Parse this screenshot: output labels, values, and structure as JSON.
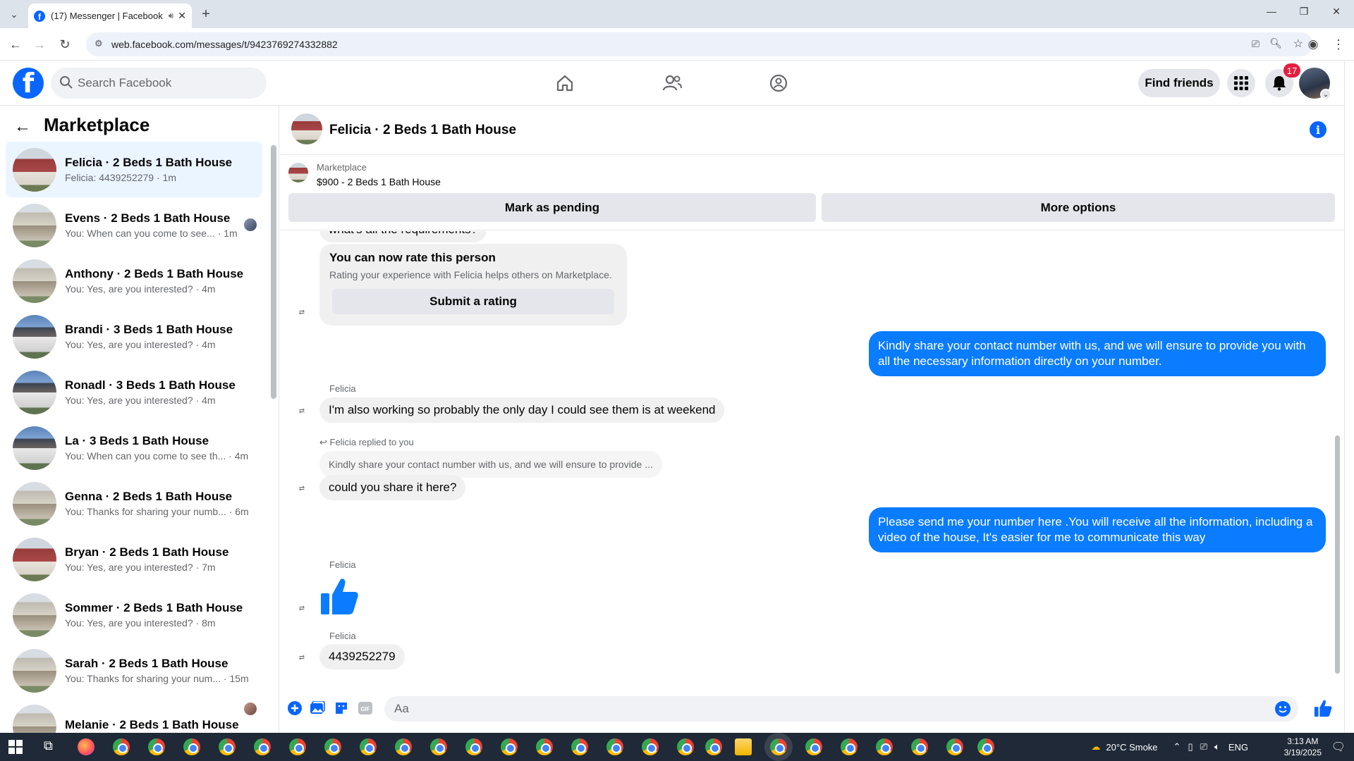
{
  "browser": {
    "tab_title": "(17) Messenger | Facebook",
    "url": "web.facebook.com/messages/t/9423769274332882"
  },
  "fb": {
    "search_placeholder": "Search Facebook",
    "find_friends": "Find friends",
    "notif_count": "17"
  },
  "sidebar": {
    "title": "Marketplace",
    "conversations": [
      {
        "name": "Felicia · 2 Beds 1 Bath House",
        "preview": "Felicia: 4439252279 · 1m",
        "thumb": "house1",
        "active": true
      },
      {
        "name": "Evens · 2 Beds 1 Bath House",
        "preview": "You: When can you come to see... · 1m",
        "thumb": "house2",
        "seen": true
      },
      {
        "name": "Anthony · 2 Beds 1 Bath House",
        "preview": "You: Yes, are you interested? · 4m",
        "thumb": "house2"
      },
      {
        "name": "Brandi · 3 Beds 1 Bath House",
        "preview": "You: Yes, are you interested? · 4m",
        "thumb": "house3"
      },
      {
        "name": "Ronadl · 3 Beds 1 Bath House",
        "preview": "You: Yes, are you interested? · 4m",
        "thumb": "house3"
      },
      {
        "name": "La · 3 Beds 1 Bath House",
        "preview": "You: When can you come to see th... · 4m",
        "thumb": "house3"
      },
      {
        "name": "Genna · 2 Beds 1 Bath House",
        "preview": "You: Thanks for sharing your numb... · 6m",
        "thumb": "house2"
      },
      {
        "name": "Bryan · 2 Beds 1 Bath House",
        "preview": "You: Yes, are you interested? · 7m",
        "thumb": "house1"
      },
      {
        "name": "Sommer · 2 Beds 1 Bath House",
        "preview": "You: Yes, are you interested? · 8m",
        "thumb": "house2"
      },
      {
        "name": "Sarah · 2 Beds 1 Bath House",
        "preview": "You: Thanks for sharing your num... · 15m",
        "thumb": "house2"
      },
      {
        "name": "Melanie · 2 Beds 1 Bath House",
        "preview": "",
        "thumb": "house2",
        "seen": true
      }
    ]
  },
  "chat": {
    "title": "Felicia · 2 Beds 1 Bath House",
    "listing_label": "Marketplace",
    "listing_price": "$900 - 2 Beds 1 Bath House",
    "mark_pending": "Mark as pending",
    "more_options": "More options",
    "partial_msg": "what's all the requirements?",
    "rate_title": "You can now rate this person",
    "rate_sub": "Rating your experience with Felicia helps others on Marketplace.",
    "rate_btn": "Submit a rating",
    "out1": "Kindly share your contact number with us, and we will ensure to provide you with all the necessary information directly on your number.",
    "sender": "Felicia",
    "in1": "I'm also working so probably the only day I could see them is at weekend",
    "replied_to": "Felicia replied to you",
    "quoted": "Kindly share your contact number with us, and we will ensure to provide ...",
    "in2": "could you share it here?",
    "out2": "Please send me your number here .You will receive all the information, including a video of the house,  It's easier for me to communicate this way",
    "in3": "4439252279",
    "input_placeholder": "Aa"
  },
  "taskbar": {
    "weather": "20°C  Smoke",
    "lang": "ENG",
    "time": "3:13 AM",
    "date": "3/19/2025"
  },
  "colors": {
    "fb_blue": "#0866ff",
    "out_bubble": "#0a7cff",
    "badge_red": "#e41e3f"
  }
}
